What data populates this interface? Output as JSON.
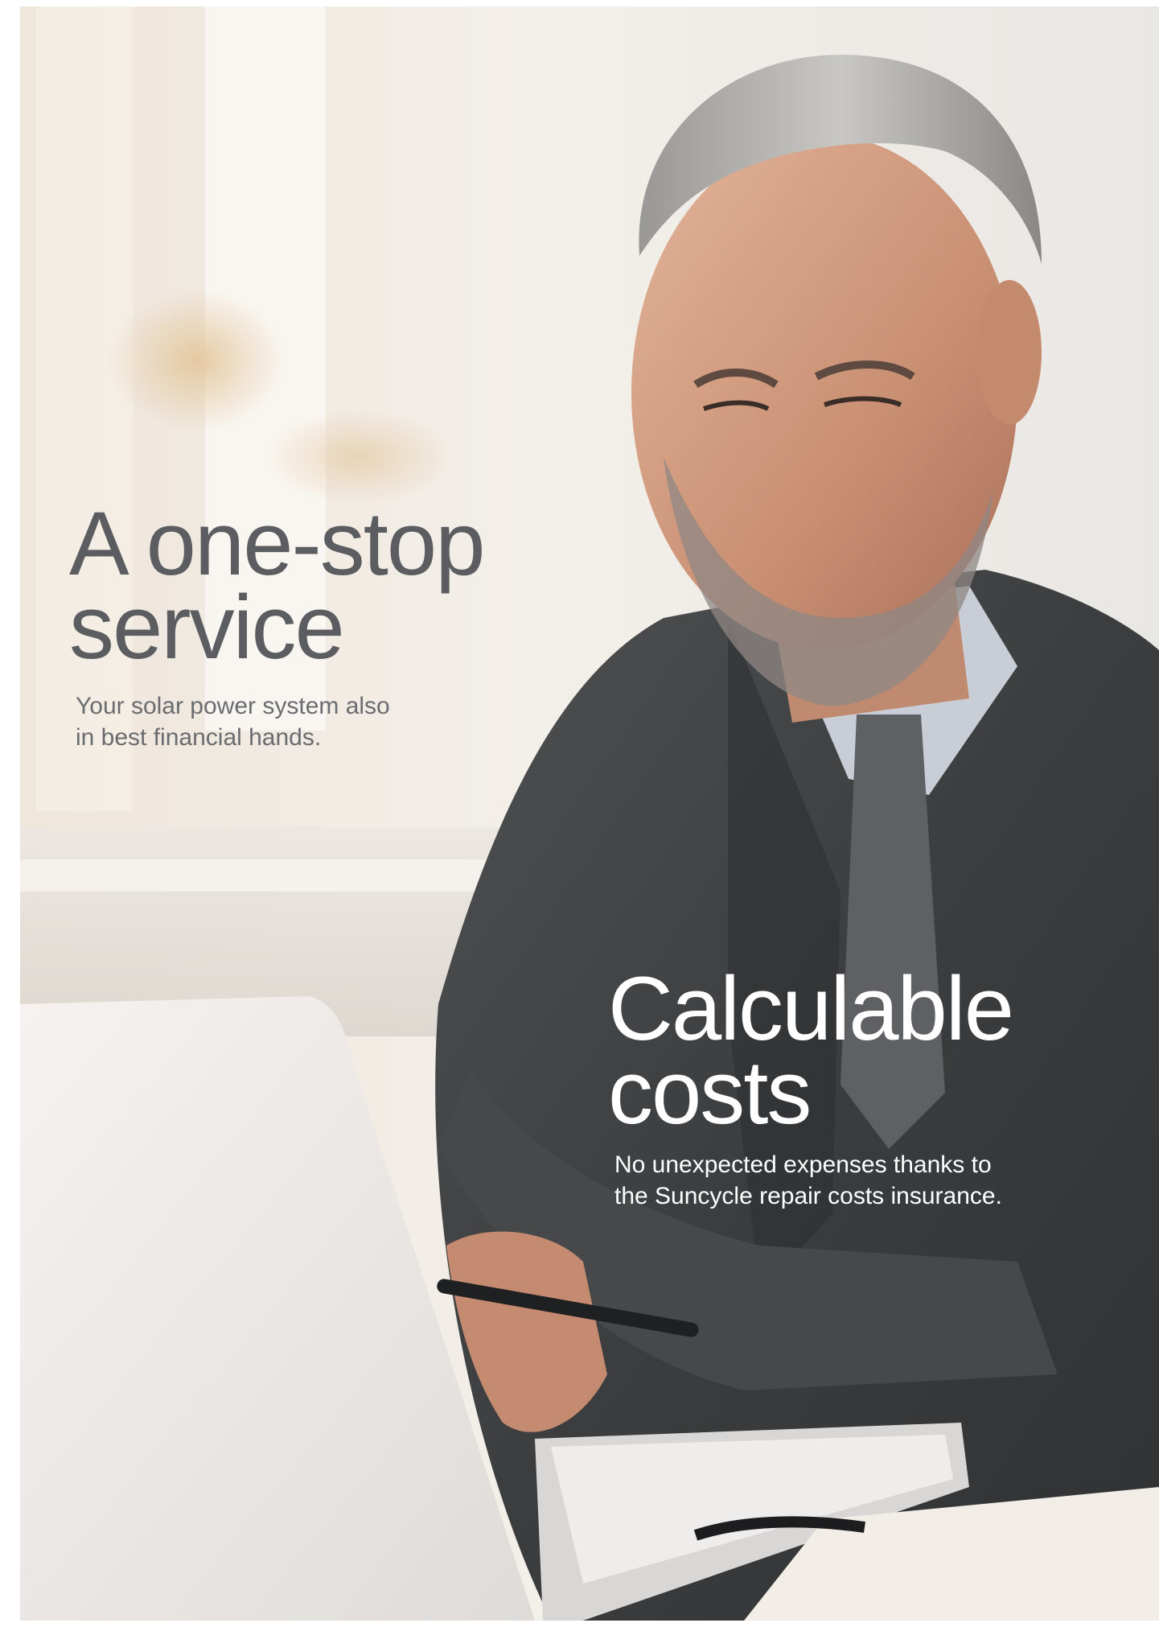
{
  "page": {
    "background": "#ffffff"
  },
  "photo": {
    "subject": "businessman-at-laptop"
  },
  "sections": {
    "one_stop": {
      "title_line1": "A one-stop",
      "title_line2": "service",
      "subtitle_line1": "Your solar power system also",
      "subtitle_line2": "in best financial hands.",
      "color": "#5b5d60"
    },
    "calculable": {
      "title_line1": "Calculable",
      "title_line2": "costs",
      "subtitle_line1": "No unexpected expenses thanks to",
      "subtitle_line2": "the Suncycle repair costs insurance.",
      "color": "#ffffff"
    }
  }
}
